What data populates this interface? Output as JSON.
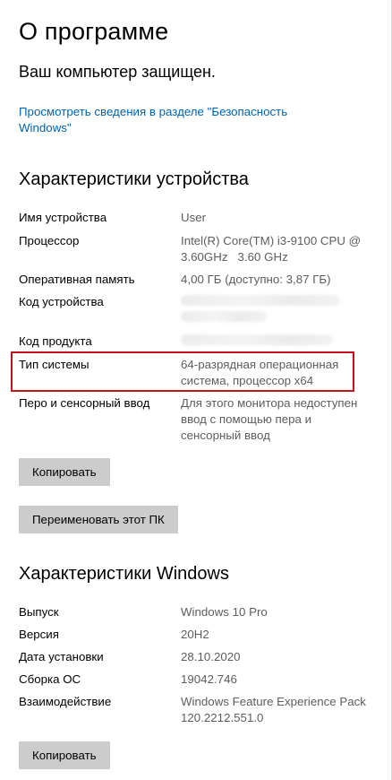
{
  "page_title": "О программе",
  "protection_status": "Ваш компьютер защищен.",
  "security_link": "Просмотреть сведения в разделе \"Безопасность Windows\"",
  "device_specs": {
    "title": "Характеристики устройства",
    "rows": [
      {
        "label": "Имя устройства",
        "value": "User"
      },
      {
        "label": "Процессор",
        "value": "Intel(R) Core(TM) i3-9100 CPU @ 3.60GHz   3.60 GHz"
      },
      {
        "label": "Оперативная память",
        "value": "4,00 ГБ (доступно: 3,87 ГБ)"
      },
      {
        "label": "Код устройства",
        "value": ""
      },
      {
        "label": "Код продукта",
        "value": ""
      },
      {
        "label": "Тип системы",
        "value": "64-разрядная операционная система, процессор x64"
      },
      {
        "label": "Перо и сенсорный ввод",
        "value": "Для этого монитора недоступен ввод с помощью пера и сенсорный ввод"
      }
    ],
    "copy_button": "Копировать",
    "rename_button": "Переименовать этот ПК"
  },
  "windows_specs": {
    "title": "Характеристики Windows",
    "rows": [
      {
        "label": "Выпуск",
        "value": "Windows 10 Pro"
      },
      {
        "label": "Версия",
        "value": "20H2"
      },
      {
        "label": "Дата установки",
        "value": "28.10.2020"
      },
      {
        "label": "Сборка ОС",
        "value": "19042.746"
      },
      {
        "label": "Взаимодействие",
        "value": "Windows Feature Experience Pack 120.2212.551.0"
      }
    ],
    "copy_button": "Копировать"
  },
  "colors": {
    "link": "#0063b1",
    "highlight": "#c0141c",
    "button": "#cccccc",
    "value_text": "#5d5d5d"
  }
}
